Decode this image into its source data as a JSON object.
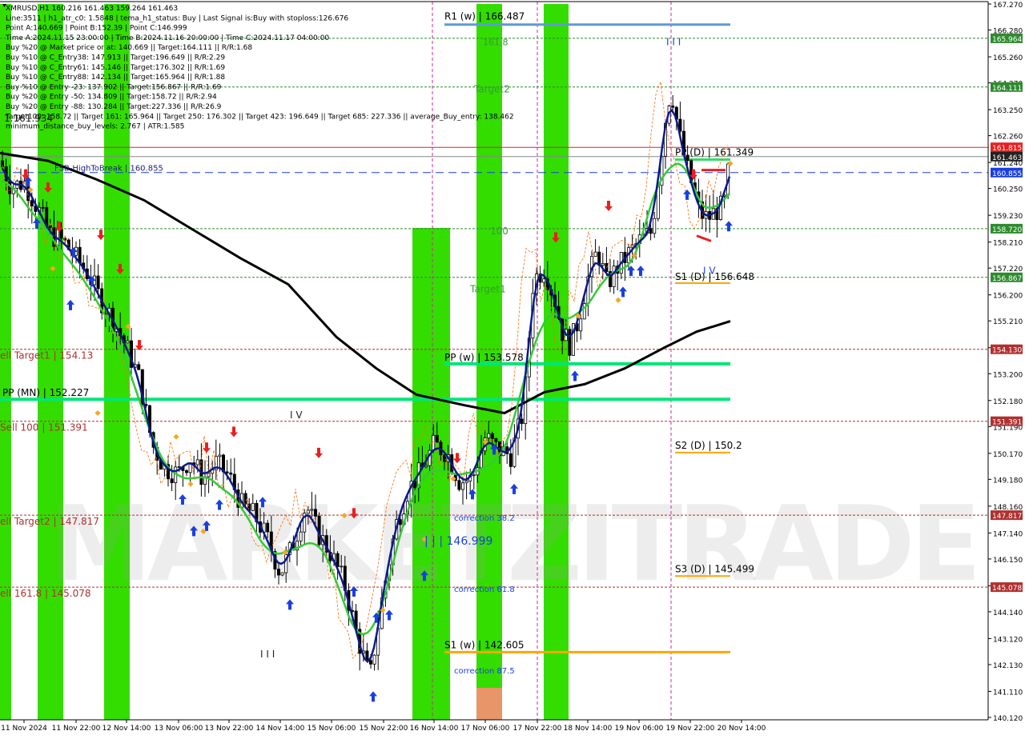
{
  "chart_data": {
    "type": "candlestick",
    "symbol_line": "XMRUSD,H1  160.216 161.463 159.264 161.463",
    "info_lines": [
      "XMRUSD,H1  160.216 161.463 159.264 161.463",
      "Line:3511 | h1_atr_c0: 1.5848 | tema_h1_status: Buy | Last Signal is:Buy with stoploss:126.676",
      "Point A:140.669 | Point B:152.39 | Point C:146.999",
      "Time A:2024.11.15 23:00:00 | Time B:2024.11.16 20:00:00 | Time C:2024.11.17 04:00:00",
      "Buy %20 @ Market price or at: 140.669 || Target:164.111 || R/R:1.68",
      "Buy %10 @ C_Entry38: 147.913 || Target:196.649 || R/R:2.29",
      "Buy %10 @ C_Entry61: 145.146 || Target:176.302 || R/R:1.69",
      "Buy %10 @ C_Entry88: 142.134 || Target:165.964 || R/R:1.88",
      "Buy %10 @ Entry -23: 137.902 || Target:156.867 || R/R:1.69",
      "Buy %20 @ Entry -50: 134.809 || Target:158.72 || R/R:2.94",
      "Buy %20 @ Entry -88: 130.284 || Target:227.336 || R/R:26.9",
      "Target100: 158.72 || Target 161: 165.964 || Target 250: 176.302 || Target 423: 196.649 || Target 685: 227.336 || average_Buy_entry: 138.462",
      "minimum_distance_buy_levels: 2.767 | ATR:1.585"
    ],
    "y_axis": {
      "min": 140.12,
      "max": 167.27,
      "ticks": [
        "167.270",
        "166.280",
        "165.260",
        "164.270",
        "163.250",
        "162.260",
        "161.240",
        "160.250",
        "159.230",
        "158.210",
        "157.220",
        "156.200",
        "155.210",
        "154.190",
        "153.200",
        "152.180",
        "151.190",
        "150.170",
        "149.180",
        "148.160",
        "147.140",
        "146.150",
        "145.130",
        "144.140",
        "143.120",
        "142.130",
        "141.110",
        "140.120"
      ]
    },
    "x_axis": {
      "ticks": [
        "11 Nov 2024",
        "11 Nov 22:00",
        "12 Nov 14:00",
        "13 Nov 06:00",
        "13 Nov 22:00",
        "14 Nov 14:00",
        "15 Nov 06:00",
        "15 Nov 22:00",
        "16 Nov 14:00",
        "17 Nov 06:00",
        "17 Nov 22:00",
        "18 Nov 14:00",
        "19 Nov 06:00",
        "19 Nov 22:00",
        "20 Nov 14:00"
      ]
    },
    "price_badges": [
      {
        "value": "165.964",
        "price": 165.964,
        "color": "#2e8b2e"
      },
      {
        "value": "164.111",
        "price": 164.111,
        "color": "#2e8b2e"
      },
      {
        "value": "161.815",
        "price": 161.815,
        "color": "#e82020"
      },
      {
        "value": "161.463",
        "price": 161.463,
        "color": "#222222"
      },
      {
        "value": "160.855",
        "price": 160.855,
        "color": "#1a3fe0"
      },
      {
        "value": "158.720",
        "price": 158.72,
        "color": "#2e8b2e"
      },
      {
        "value": "156.867",
        "price": 156.867,
        "color": "#2e8b2e"
      },
      {
        "value": "154.130",
        "price": 154.13,
        "color": "#b03030"
      },
      {
        "value": "151.391",
        "price": 151.391,
        "color": "#b03030"
      },
      {
        "value": "147.817",
        "price": 147.817,
        "color": "#b03030"
      },
      {
        "value": "145.078",
        "price": 145.078,
        "color": "#b03030"
      }
    ],
    "levels": [
      {
        "label": "R1 (w) | 166.487",
        "price": 166.487,
        "color": "#5b9bd5"
      },
      {
        "label": "PP (D) | 161.349",
        "price": 161.349,
        "color": "#33dd66"
      },
      {
        "label": "S1 (D) | 156.648",
        "price": 156.648,
        "color": "#ffa500"
      },
      {
        "label": "PP (w) | 153.578",
        "price": 153.578,
        "color": "#00e676"
      },
      {
        "label": "PP (MN) | 152.227",
        "price": 152.227,
        "color": "#00e676"
      },
      {
        "label": "S2 (D) | 150.2",
        "price": 150.2,
        "color": "#ffa500"
      },
      {
        "label": "S3 (D) | 145.499",
        "price": 145.499,
        "color": "#ffa500"
      },
      {
        "label": "S1 (w) | 142.605",
        "price": 142.605,
        "color": "#ffa500"
      }
    ],
    "sell_labels": [
      {
        "label": "ell Target1 | 154.13",
        "price": 154.13
      },
      {
        "label": "Sell 100 | 151.391",
        "price": 151.391
      },
      {
        "label": "ell Target2 | 147.817",
        "price": 147.817
      },
      {
        "label": "ell 161.8 | 145.078",
        "price": 145.078
      }
    ],
    "annotations": [
      {
        "text": "161.8",
        "color": "#3a9a3a"
      },
      {
        "text": "Target2",
        "color": "#3a9a3a"
      },
      {
        "text": "100",
        "color": "#3a9a3a"
      },
      {
        "text": "Target1",
        "color": "#3a9a3a"
      },
      {
        "text": "correction 38.2",
        "color": "#1a3fe0"
      },
      {
        "text": "correction 61.8",
        "color": "#1a3fe0"
      },
      {
        "text": "correction 87.5",
        "color": "#1a3fe0"
      },
      {
        "text": "| | | 146.999",
        "color": "#1a3fe0"
      },
      {
        "text": "FSB-HighToBreak | 160.855",
        "color": "#1a1a80"
      },
      {
        "text": "I V",
        "color": "#1a3fe0"
      },
      {
        "text": "I V",
        "color": "#222222"
      },
      {
        "text": "I I I",
        "color": "#1a3fe0"
      },
      {
        "text": "I I I",
        "color": "#222222"
      },
      {
        "text": "1.161.934",
        "color": "#222222"
      }
    ],
    "watermark": "MARKETZITRADE",
    "colors": {
      "up_candle": "#000000",
      "down_candle": "#000000",
      "tema_blue": "#0a1a8c",
      "ma_green": "#33cc33",
      "ma_black": "#000000",
      "zone_green": "#33dd00",
      "zone_salmon": "#e8956a",
      "buy_arrow": "#1a3fe0",
      "sell_arrow": "#e82020"
    }
  }
}
